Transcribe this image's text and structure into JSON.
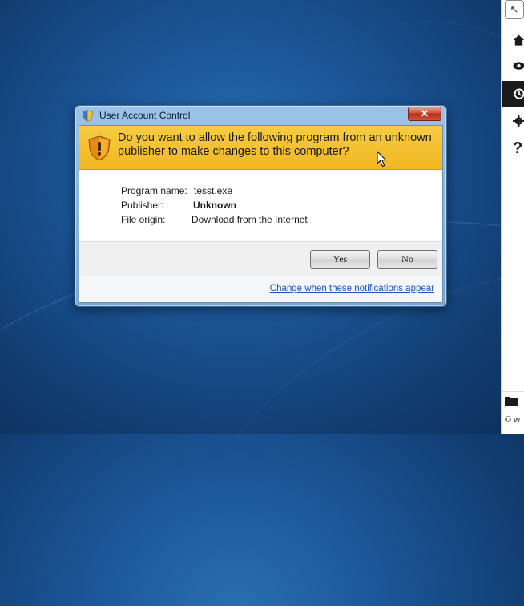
{
  "dialog": {
    "title": "User Account Control",
    "close_label": "✕",
    "question": "Do you want to allow the following program from an unknown publisher to make changes to this computer?",
    "details": [
      {
        "label": "Program name:",
        "value": "tesst.exe"
      },
      {
        "label": "Publisher:",
        "value": "Unknown"
      },
      {
        "label": "File origin:",
        "value": "Download from the Internet"
      }
    ],
    "yes_label": "Yes",
    "no_label": "No",
    "notifications_link": "Change when these notifications appear"
  },
  "side_panel": {
    "footer_text": "© w"
  },
  "colors": {
    "banner": "#f3c12c",
    "desktop": "#1c5799",
    "link": "#1a55c4",
    "active_tool": "#1b1b1b"
  },
  "icons": [
    "shield-icon",
    "warning-shield-icon",
    "cursor-icon",
    "home-icon",
    "eye-icon",
    "history-icon",
    "gear-icon",
    "help-icon",
    "folder-icon",
    "mouse-pointer-icon"
  ]
}
